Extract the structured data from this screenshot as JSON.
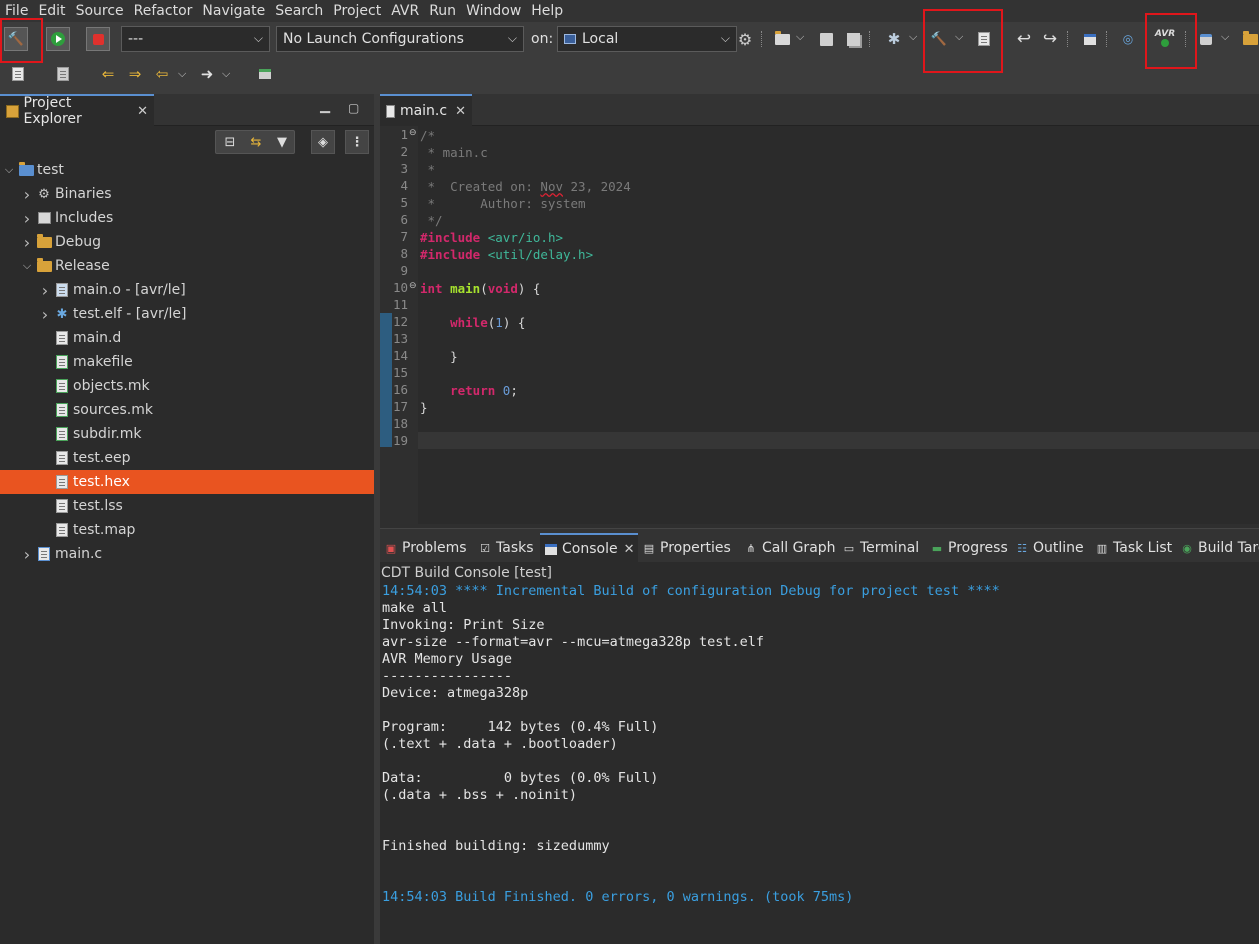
{
  "menubar": [
    "File",
    "Edit",
    "Source",
    "Refactor",
    "Navigate",
    "Search",
    "Project",
    "AVR",
    "Run",
    "Window",
    "Help"
  ],
  "toolbar": {
    "launch_mode": "---",
    "launch_config": "No Launch Configurations",
    "on_label": "on:",
    "target": "Local",
    "avr_label": "AVR"
  },
  "explorer": {
    "tab_label": "Project Explorer",
    "tree": [
      {
        "label": "test",
        "depth": 0,
        "twisty": "v",
        "icon": "project"
      },
      {
        "label": "Binaries",
        "depth": 1,
        "twisty": ">",
        "icon": "binaries"
      },
      {
        "label": "Includes",
        "depth": 1,
        "twisty": ">",
        "icon": "includes"
      },
      {
        "label": "Debug",
        "depth": 1,
        "twisty": ">",
        "icon": "folder"
      },
      {
        "label": "Release",
        "depth": 1,
        "twisty": "v",
        "icon": "folder"
      },
      {
        "label": "main.o - [avr/le]",
        "depth": 2,
        "twisty": ">",
        "icon": "object"
      },
      {
        "label": "test.elf - [avr/le]",
        "depth": 2,
        "twisty": ">",
        "icon": "elf"
      },
      {
        "label": "main.d",
        "depth": 2,
        "twisty": "",
        "icon": "file"
      },
      {
        "label": "makefile",
        "depth": 2,
        "twisty": "",
        "icon": "makefile"
      },
      {
        "label": "objects.mk",
        "depth": 2,
        "twisty": "",
        "icon": "makefile"
      },
      {
        "label": "sources.mk",
        "depth": 2,
        "twisty": "",
        "icon": "makefile"
      },
      {
        "label": "subdir.mk",
        "depth": 2,
        "twisty": "",
        "icon": "makefile"
      },
      {
        "label": "test.eep",
        "depth": 2,
        "twisty": "",
        "icon": "file"
      },
      {
        "label": "test.hex",
        "depth": 2,
        "twisty": "",
        "icon": "file",
        "selected": true
      },
      {
        "label": "test.lss",
        "depth": 2,
        "twisty": "",
        "icon": "file"
      },
      {
        "label": "test.map",
        "depth": 2,
        "twisty": "",
        "icon": "file"
      },
      {
        "label": "main.c",
        "depth": 1,
        "twisty": ">",
        "icon": "csource"
      }
    ]
  },
  "editor": {
    "tab_label": "main.c",
    "line_numbers": [
      "1",
      "2",
      "3",
      "4",
      "5",
      "6",
      "7",
      "8",
      "9",
      "10",
      "11",
      "12",
      "13",
      "14",
      "15",
      "16",
      "17",
      "18",
      "19"
    ],
    "lines": [
      {
        "n": 1,
        "parts": [
          {
            "t": "/*",
            "c": "cm"
          }
        ]
      },
      {
        "n": 2,
        "parts": [
          {
            "t": " * main.c",
            "c": "cm"
          }
        ]
      },
      {
        "n": 3,
        "parts": [
          {
            "t": " *",
            "c": "cm"
          }
        ]
      },
      {
        "n": 4,
        "parts": [
          {
            "t": " *  Created on: ",
            "c": "cm"
          },
          {
            "t": "Nov",
            "c": "cm squig"
          },
          {
            "t": " 23, 2024",
            "c": "cm"
          }
        ]
      },
      {
        "n": 5,
        "parts": [
          {
            "t": " *      Author: system",
            "c": "cm"
          }
        ]
      },
      {
        "n": 6,
        "parts": [
          {
            "t": " */",
            "c": "cm"
          }
        ]
      },
      {
        "n": 7,
        "parts": [
          {
            "t": "#include",
            "c": "kw"
          },
          {
            "t": " ",
            "c": ""
          },
          {
            "t": "<avr/io.h>",
            "c": "inc"
          }
        ]
      },
      {
        "n": 8,
        "parts": [
          {
            "t": "#include",
            "c": "kw"
          },
          {
            "t": " ",
            "c": ""
          },
          {
            "t": "<util/delay.h>",
            "c": "inc"
          }
        ]
      },
      {
        "n": 9,
        "parts": []
      },
      {
        "n": 10,
        "parts": [
          {
            "t": "int",
            "c": "kw"
          },
          {
            "t": " ",
            "c": ""
          },
          {
            "t": "main",
            "c": "fn"
          },
          {
            "t": "(",
            "c": ""
          },
          {
            "t": "void",
            "c": "kw"
          },
          {
            "t": ") {",
            "c": ""
          }
        ]
      },
      {
        "n": 11,
        "parts": []
      },
      {
        "n": 12,
        "parts": [
          {
            "t": "    ",
            "c": ""
          },
          {
            "t": "while",
            "c": "kw"
          },
          {
            "t": "(",
            "c": ""
          },
          {
            "t": "1",
            "c": "num"
          },
          {
            "t": ") {",
            "c": ""
          }
        ]
      },
      {
        "n": 13,
        "parts": []
      },
      {
        "n": 14,
        "parts": [
          {
            "t": "    }",
            "c": ""
          }
        ]
      },
      {
        "n": 15,
        "parts": []
      },
      {
        "n": 16,
        "parts": [
          {
            "t": "    ",
            "c": ""
          },
          {
            "t": "return",
            "c": "kw"
          },
          {
            "t": " ",
            "c": ""
          },
          {
            "t": "0",
            "c": "num"
          },
          {
            "t": ";",
            "c": ""
          }
        ]
      },
      {
        "n": 17,
        "parts": [
          {
            "t": "}",
            "c": ""
          }
        ]
      },
      {
        "n": 18,
        "parts": []
      },
      {
        "n": 19,
        "parts": []
      }
    ]
  },
  "panel": {
    "tabs": [
      {
        "label": "Problems",
        "icon": "problems"
      },
      {
        "label": "Tasks",
        "icon": "tasks"
      },
      {
        "label": "Console",
        "icon": "console",
        "active": true
      },
      {
        "label": "Properties",
        "icon": "properties"
      },
      {
        "label": "Call Graph",
        "icon": "callgraph"
      },
      {
        "label": "Terminal",
        "icon": "terminal"
      },
      {
        "label": "Progress",
        "icon": "progress"
      },
      {
        "label": "Outline",
        "icon": "outline"
      },
      {
        "label": "Task List",
        "icon": "tasklist"
      },
      {
        "label": "Build Targ",
        "icon": "buildtargets"
      }
    ],
    "console_title": "CDT Build Console [test]",
    "console_lines": [
      {
        "t": "14:54:03 **** Incremental Build of configuration Debug for project test ****",
        "blue": true
      },
      {
        "t": "make all"
      },
      {
        "t": "Invoking: Print Size"
      },
      {
        "t": "avr-size --format=avr --mcu=atmega328p test.elf"
      },
      {
        "t": "AVR Memory Usage"
      },
      {
        "t": "----------------"
      },
      {
        "t": "Device: atmega328p"
      },
      {
        "t": ""
      },
      {
        "t": "Program:     142 bytes (0.4% Full)"
      },
      {
        "t": "(.text + .data + .bootloader)"
      },
      {
        "t": ""
      },
      {
        "t": "Data:          0 bytes (0.0% Full)"
      },
      {
        "t": "(.data + .bss + .noinit)"
      },
      {
        "t": ""
      },
      {
        "t": ""
      },
      {
        "t": "Finished building: sizedummy"
      },
      {
        "t": ""
      },
      {
        "t": ""
      },
      {
        "t": "14:54:03 Build Finished. 0 errors, 0 warnings. (took 75ms)",
        "blue": true
      }
    ]
  }
}
